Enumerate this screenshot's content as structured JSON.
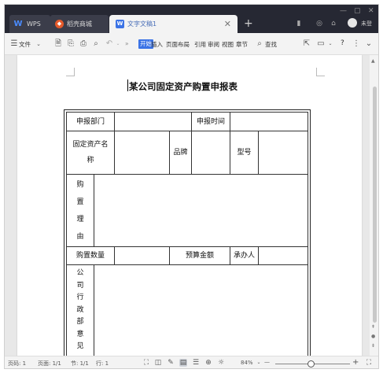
{
  "titlebar": {
    "tabs": [
      {
        "label": "WPS",
        "icon": "wps-logo-icon"
      },
      {
        "label": "稻壳商城",
        "icon": "daoke-store-icon"
      },
      {
        "label": "文字文稿1",
        "icon": "word-doc-icon",
        "active": true
      }
    ],
    "new_tab": "+",
    "login_label": "未登"
  },
  "menubar": {
    "file": "文件",
    "overflow": "»",
    "items": [
      "开始",
      "插入",
      "页面布局",
      "引用",
      "审阅",
      "视图",
      "章节"
    ],
    "search": "查找",
    "help": "?"
  },
  "document": {
    "title": "某公司固定资产购置申报表",
    "form": {
      "dept_label": "申报部门",
      "time_label": "申报时间",
      "asset_name_label_1": "固定资产名",
      "asset_name_label_2": "称",
      "brand_label": "品牌",
      "model_label": "型号",
      "reason_chars": [
        "购",
        "置",
        "理",
        "由"
      ],
      "quantity_label": "购置数量",
      "budget_label": "预算金额",
      "handler_label": "承办人",
      "opinion_chars": [
        "公",
        "司",
        "行",
        "政",
        "部",
        "意",
        "见"
      ]
    }
  },
  "statusbar": {
    "page": "页码: 1",
    "pages": "页面: 1/1",
    "section": "节: 1/1",
    "line": "行: 1",
    "zoom": "84%",
    "zoom_out": "—",
    "zoom_in": "+"
  },
  "colors": {
    "titlebar_bg": "#262833",
    "accent": "#3b73e6"
  }
}
